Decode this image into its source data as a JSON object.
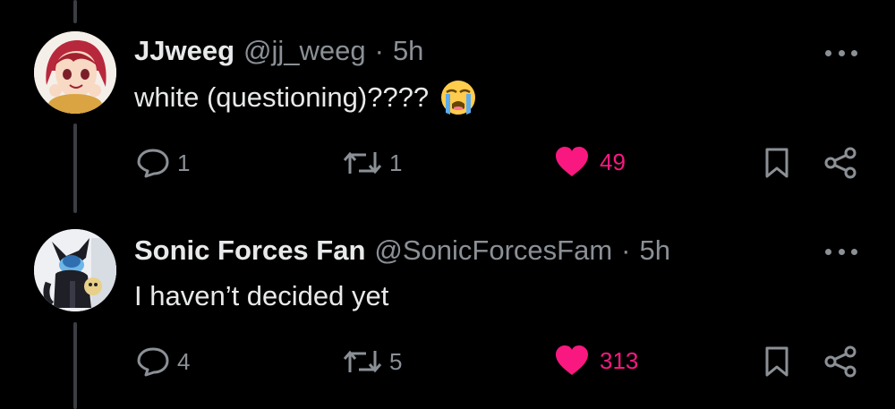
{
  "colors": {
    "background": "#000000",
    "text_primary": "#e7e9ea",
    "text_secondary": "#8b9096",
    "like_active": "#f91880",
    "thread_line": "#3a3d41"
  },
  "tweets": [
    {
      "display_name": "JJweeg",
      "handle": "@jj_weeg",
      "separator": "·",
      "time": "5h",
      "text": "white (questioning)????",
      "emoji": "😭",
      "replies": "1",
      "retweets": "1",
      "likes": "49",
      "liked": true,
      "icons": [
        "reply-icon",
        "retweet-icon",
        "heart-icon",
        "bookmark-icon",
        "share-icon",
        "more-icon"
      ]
    },
    {
      "display_name": "Sonic Forces Fan",
      "handle": "@SonicForcesFam",
      "separator": "·",
      "time": "5h",
      "text": "I haven’t decided yet",
      "replies": "4",
      "retweets": "5",
      "likes": "313",
      "liked": true,
      "icons": [
        "reply-icon",
        "retweet-icon",
        "heart-icon",
        "bookmark-icon",
        "share-icon",
        "more-icon"
      ]
    }
  ]
}
